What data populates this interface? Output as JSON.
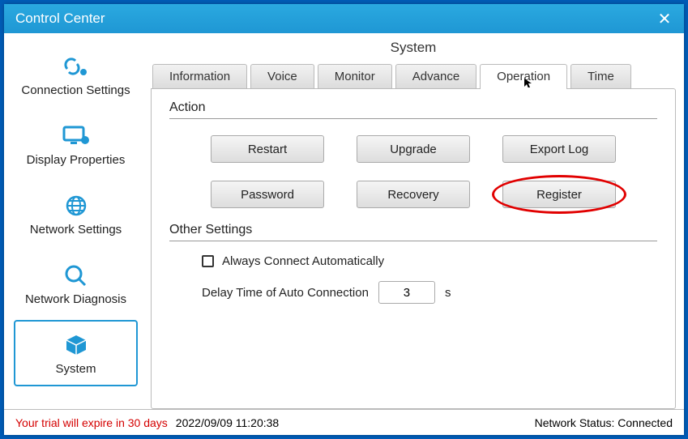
{
  "window": {
    "title": "Control Center"
  },
  "sidebar": {
    "items": [
      {
        "label": "Connection Settings"
      },
      {
        "label": "Display Properties"
      },
      {
        "label": "Network Settings"
      },
      {
        "label": "Network Diagnosis"
      },
      {
        "label": "System"
      }
    ]
  },
  "page": {
    "title": "System"
  },
  "tabs": [
    {
      "label": "Information"
    },
    {
      "label": "Voice"
    },
    {
      "label": "Monitor"
    },
    {
      "label": "Advance"
    },
    {
      "label": "Operation"
    },
    {
      "label": "Time"
    }
  ],
  "action": {
    "section_title": "Action",
    "buttons": {
      "restart": "Restart",
      "upgrade": "Upgrade",
      "export_log": "Export Log",
      "password": "Password",
      "recovery": "Recovery",
      "register": "Register"
    }
  },
  "other": {
    "section_title": "Other Settings",
    "auto_connect_label": "Always Connect Automatically",
    "auto_connect_checked": false,
    "delay_label": "Delay Time of Auto Connection",
    "delay_value": "3",
    "delay_unit": "s"
  },
  "status": {
    "trial_warning": "Your trial will expire in 30 days",
    "timestamp": "2022/09/09 11:20:38",
    "network_label": "Network Status: Connected"
  }
}
